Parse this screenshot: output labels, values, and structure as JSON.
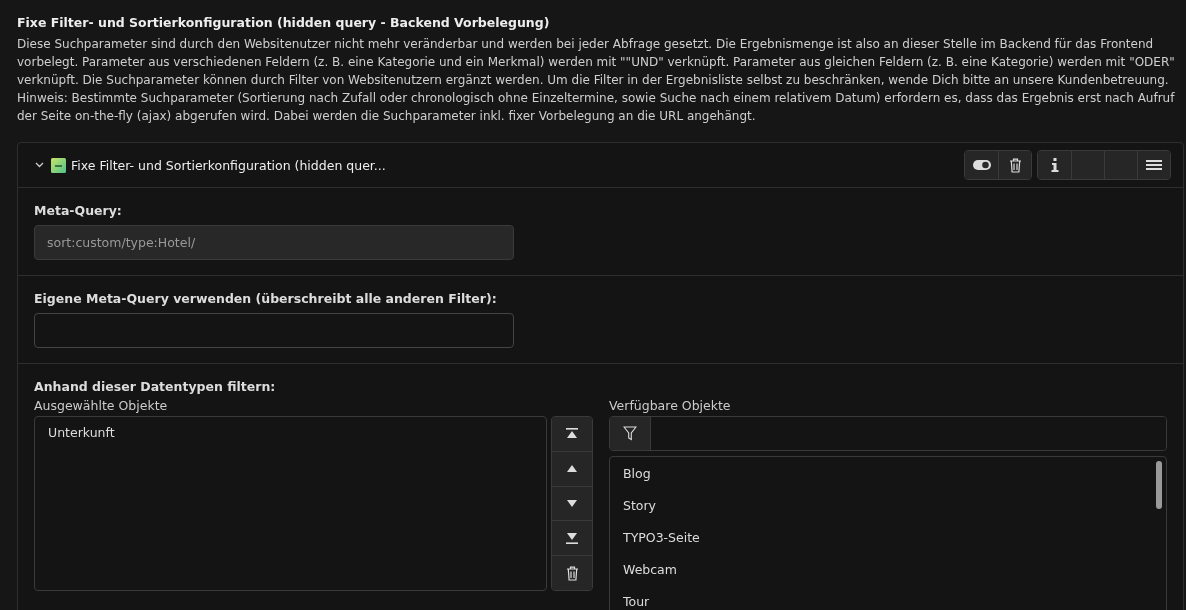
{
  "heading": "Fixe Filter- und Sortierkonfiguration (hidden query - Backend Vorbelegung)",
  "description": "Diese Suchparameter sind durch den Websitenutzer nicht mehr veränderbar und werden bei jeder Abfrage gesetzt. Die Ergebnismenge ist also an dieser Stelle im Backend für das Frontend vorbelegt. Parameter aus verschiedenen Feldern (z. B. eine Kategorie und ein Merkmal) werden mit \"\"UND\" verknüpft. Parameter aus gleichen Feldern (z. B. eine Kategorie) werden mit \"ODER\" verknüpft. Die Suchparameter können durch Filter von Websitenutzern ergänzt werden. Um die Filter in der Ergebnisliste selbst zu beschränken, wende Dich bitte an unsere Kundenbetreuung. Hinweis: Bestimmte Suchparameter (Sortierung nach Zufall oder chronologisch ohne Einzeltermine, sowie Suche nach einem relativem Datum) erfordern es, dass das Ergebnis erst nach Aufruf der Seite on-the-fly (ajax) abgerufen wird. Dabei werden die Suchparameter inkl. fixer Vorbelegung an die URL angehängt.",
  "panel": {
    "title": "Fixe Filter- und Sortierkonfiguration (hidden quer...",
    "expanded": true,
    "toolbar": [
      {
        "kind": "toggle"
      },
      {
        "kind": "delete"
      },
      {
        "kind": "info"
      },
      {
        "kind": "blank"
      },
      {
        "kind": "blank"
      },
      {
        "kind": "menu"
      }
    ],
    "meta_query": {
      "label": "Meta-Query:",
      "value": "sort:custom/type:Hotel/",
      "readonly": true
    },
    "custom_query": {
      "label": "Eigene Meta-Query verwenden (überschreibt alle anderen Filter):"
    },
    "types": {
      "label": "Anhand dieser Datentypen filtern:",
      "selected_label": "Ausgewählte Objekte",
      "selected_items": [
        "Unterkunft"
      ],
      "move_buttons": [
        {
          "kind": "top"
        },
        {
          "kind": "up"
        },
        {
          "kind": "down"
        },
        {
          "kind": "bottom"
        },
        {
          "kind": "delete"
        }
      ],
      "available_label": "Verfügbare Objekte",
      "available_items": [
        "Blog",
        "Story",
        "TYPO3-Seite",
        "Webcam",
        "Tour"
      ]
    }
  }
}
